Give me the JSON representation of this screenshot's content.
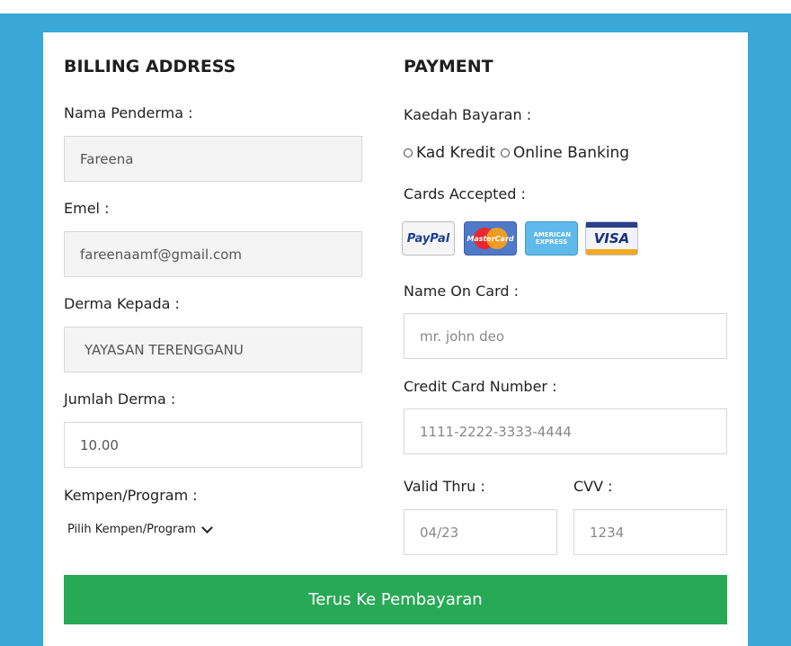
{
  "billing": {
    "heading": "BILLING ADDRESS",
    "name_label": "Nama Penderma :",
    "name_value": "Fareena",
    "email_label": "Emel :",
    "email_value": "fareenaamf@gmail.com",
    "derma_label": "Derma Kepada :",
    "derma_value": "YAYASAN TERENGGANU",
    "amount_label": "Jumlah Derma :",
    "amount_value": "10.00",
    "campaign_label": "Kempen/Program :",
    "campaign_select": "Pilih Kempen/Program"
  },
  "payment": {
    "heading": "PAYMENT",
    "method_label": "Kaedah Bayaran :",
    "option_credit": "Kad Kredit",
    "option_online": "Online Banking",
    "cards_label": "Cards Accepted :",
    "cards": [
      {
        "text": "PayPal",
        "icon": "paypal-icon"
      },
      {
        "text": "MasterCard",
        "icon": "mastercard-icon"
      },
      {
        "text": "AMERICAN EXPRESS",
        "icon": "amex-icon"
      },
      {
        "text": "VISA",
        "icon": "visa-icon"
      }
    ],
    "name_on_card_label": "Name On Card :",
    "name_on_card_placeholder": "mr. john deo",
    "card_number_label": "Credit Card Number :",
    "card_number_placeholder": "1111-2222-3333-4444",
    "valid_thru_label": "Valid Thru :",
    "valid_thru_placeholder": "04/23",
    "cvv_label": "CVV :",
    "cvv_placeholder": "1234"
  },
  "submit_label": "Terus Ke Pembayaran",
  "colors": {
    "background": "#3aa7d9",
    "button": "#28a956"
  }
}
